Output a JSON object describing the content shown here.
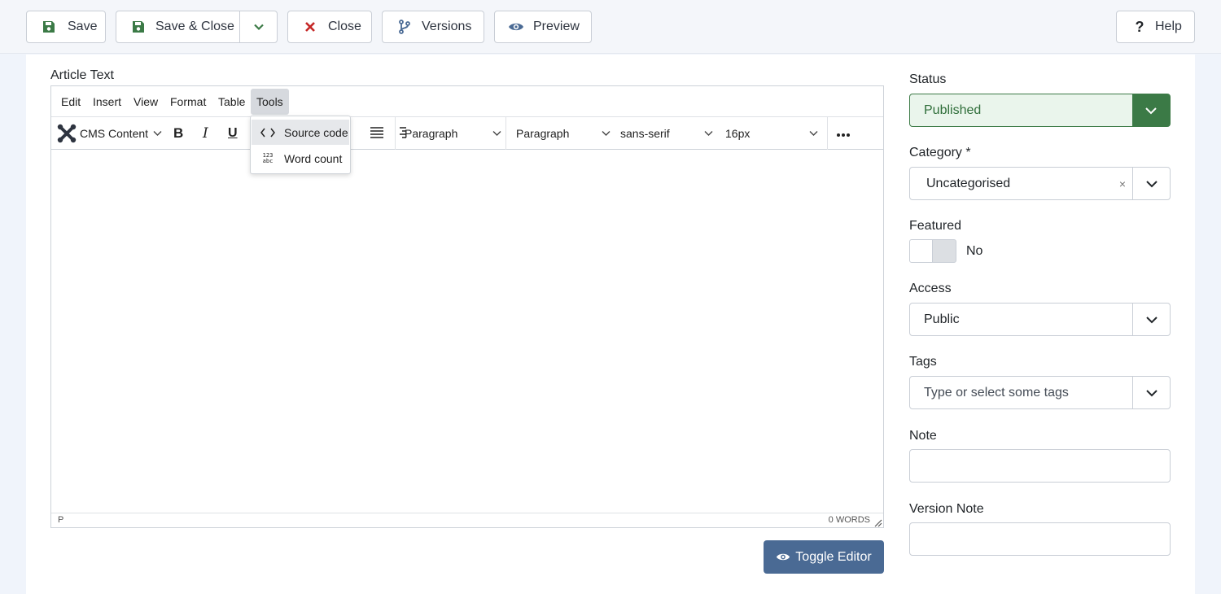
{
  "toolbar": {
    "save": "Save",
    "save_close": "Save & Close",
    "close": "Close",
    "versions": "Versions",
    "preview": "Preview",
    "help": "Help"
  },
  "editor": {
    "label": "Article Text",
    "menu": [
      "Edit",
      "Insert",
      "View",
      "Format",
      "Table",
      "Tools"
    ],
    "cms_content": "CMS Content",
    "block_format_1": "Paragraph",
    "block_format_2": "Paragraph",
    "font_family": "sans-serif",
    "font_size": "16px",
    "path": "P",
    "word_count": "0 WORDS",
    "tools_menu": [
      "Source code",
      "Word count"
    ],
    "toggle_label": "Toggle Editor"
  },
  "sidebar": {
    "status_label": "Status",
    "status_value": "Published",
    "category_label": "Category *",
    "category_value": "Uncategorised",
    "featured_label": "Featured",
    "featured_value": "No",
    "access_label": "Access",
    "access_value": "Public",
    "tags_label": "Tags",
    "tags_placeholder": "Type or select some tags",
    "note_label": "Note",
    "version_note_label": "Version Note"
  },
  "colors": {
    "accent_blue": "#4a6a94",
    "success_green": "#3b7a46",
    "danger_red": "#c52827"
  }
}
